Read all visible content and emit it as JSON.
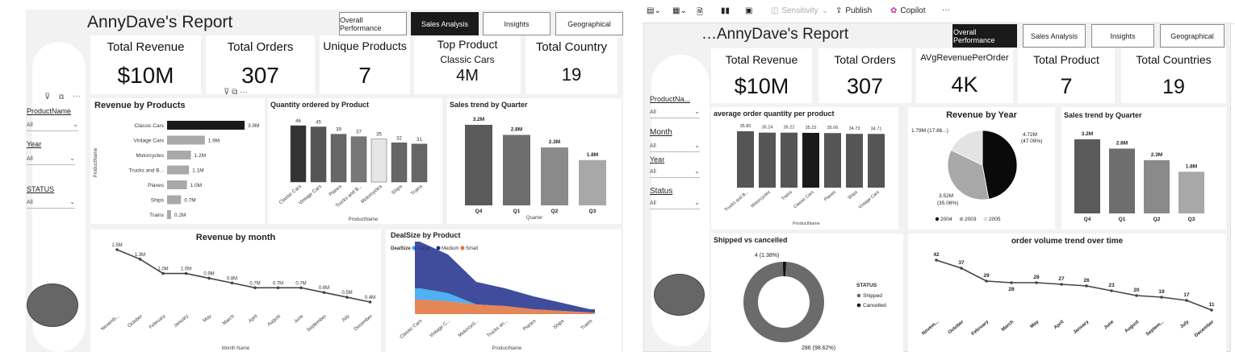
{
  "left": {
    "title": "AnnyDave's Report",
    "nav": [
      "Overall Performance",
      "Sales Analysis",
      "Insights",
      "Geographical"
    ],
    "nav_active": 1,
    "kpis": [
      {
        "title": "Total Revenue",
        "value": "$10M"
      },
      {
        "title": "Total Orders",
        "value": "307"
      },
      {
        "title": "Unique Products",
        "value": "7"
      },
      {
        "title": "Top Product",
        "subtitle": "Classic Cars",
        "value": "4M"
      },
      {
        "title": "Total Country",
        "value": "19"
      }
    ],
    "slicers": [
      {
        "label": "ProductName",
        "value": "All"
      },
      {
        "label": "Year",
        "value": "All"
      },
      {
        "label": "STATUS",
        "value": "All"
      }
    ],
    "revenue_by_products": {
      "title": "Revenue by Products",
      "ylabel": "ProductName",
      "categories": [
        "Classic Cars",
        "Vintage Cars",
        "Motorcycles",
        "Trucks and B...",
        "Planes",
        "Ships",
        "Trains"
      ],
      "values": [
        3.9,
        1.9,
        1.2,
        1.1,
        1.0,
        0.7,
        0.2
      ],
      "labels": [
        "3.9M",
        "1.9M",
        "1.2M",
        "1.1M",
        "1.0M",
        "0.7M",
        "0.2M"
      ]
    },
    "quantity_by_product": {
      "title": "Quantity ordered by Product",
      "xlabel": "ProductName",
      "categories": [
        "Classic Cars",
        "Vintage Cars",
        "Planes",
        "Trucks and B...",
        "Motorcycles",
        "Ships",
        "Trains"
      ],
      "values": [
        46,
        45,
        39,
        37,
        35,
        32,
        31
      ]
    },
    "sales_trend_quarter": {
      "title": "Sales trend by Quarter",
      "xlabel": "Quarter",
      "categories": [
        "Q4",
        "Q1",
        "Q2",
        "Q3"
      ],
      "values": [
        3.2,
        2.8,
        2.3,
        1.8
      ],
      "labels": [
        "3.2M",
        "2.8M",
        "2.3M",
        "1.8M"
      ]
    },
    "revenue_by_month": {
      "title": "Revenue by month",
      "xlabel": "Month Name",
      "categories": [
        "Novemb...",
        "October",
        "February",
        "January",
        "May",
        "March",
        "April",
        "August",
        "June",
        "September",
        "July",
        "December"
      ],
      "values": [
        1.5,
        1.3,
        1.0,
        1.0,
        0.9,
        0.8,
        0.7,
        0.7,
        0.7,
        0.6,
        0.5,
        0.4
      ],
      "labels": [
        "1.5M",
        "1.3M",
        "1.0M",
        "1.0M",
        "0.9M",
        "0.8M",
        "0.7M",
        "0.7M",
        "0.7M",
        "0.6M",
        "0.5M",
        "0.4M"
      ]
    },
    "dealsize_by_product": {
      "title": "DealSize by Product",
      "legend_title": "DealSize",
      "legend": [
        {
          "name": "Large",
          "color": "#2ea3f2"
        },
        {
          "name": "Medium",
          "color": "#1f2e8c"
        },
        {
          "name": "Small",
          "color": "#e0713a"
        }
      ],
      "xlabel": "ProductName",
      "categories": [
        "Classic Cars",
        "Vintage C...",
        "Motorcycl...",
        "Trucks an...",
        "Planes",
        "Ships",
        "Trains"
      ]
    }
  },
  "right": {
    "toolbar": {
      "sensitivity": "Sensitivity",
      "publish": "Publish",
      "copilot": "Copilot",
      "more": "···"
    },
    "title": "AnnyDave's Report",
    "nav": [
      "Overall Performance",
      "Sales Analysis",
      "Insights",
      "Geographical"
    ],
    "nav_active": 0,
    "kpis": [
      {
        "title": "Total Revenue",
        "value": "$10M"
      },
      {
        "title": "Total Orders",
        "value": "307"
      },
      {
        "title": "AVgRevenuePerOrder",
        "value": "4K"
      },
      {
        "title": "Total Product",
        "value": "7"
      },
      {
        "title": "Total Countries",
        "value": "19"
      }
    ],
    "slicers": [
      {
        "label": "ProductNa...",
        "value": "All"
      },
      {
        "label": "Month",
        "value": "All"
      },
      {
        "label": "Year",
        "value": "All"
      },
      {
        "label": "Status",
        "value": "All"
      }
    ],
    "avg_order_qty": {
      "title": "average order quantity per product",
      "xlabel": "ProductName",
      "categories": [
        "Trucks and B...",
        "Motorcycles",
        "Trains",
        "Classic Cars",
        "Planes",
        "Ships",
        "Vintage Cars"
      ],
      "values": [
        35.8,
        35.24,
        35.22,
        35.15,
        35.06,
        34.73,
        34.71
      ],
      "labels": [
        "35.80",
        "35.24",
        "35.22",
        "35.15",
        "35.06",
        "34.73",
        "34.71"
      ]
    },
    "revenue_by_year": {
      "title": "Revenue by Year",
      "slices": [
        {
          "year": "2004",
          "value": 4.72,
          "label": "4.72M\n(47.09%)",
          "color": "#0a0a0a"
        },
        {
          "year": "2003",
          "value": 3.52,
          "label": "3.52M\n(35.06%)",
          "color": "#a8a8a8"
        },
        {
          "year": "2005",
          "value": 1.79,
          "label": "1.79M (17.86...)",
          "color": "#e3e3e3"
        }
      ],
      "label_2004": [
        "4.72M",
        "(47.09%)"
      ],
      "label_2003": [
        "3.52M",
        "(35.06%)"
      ],
      "label_2005": "1.79M (17.86...)"
    },
    "sales_trend_quarter": {
      "title": "Sales trend by Quarter",
      "categories": [
        "Q4",
        "Q1",
        "Q2",
        "Q3"
      ],
      "values": [
        3.2,
        2.8,
        2.3,
        1.8
      ],
      "labels": [
        "3.2M",
        "2.8M",
        "2.3M",
        "1.8M"
      ]
    },
    "shipped_vs_cancelled": {
      "title": "Shipped vs cancelled",
      "legend_title": "STATUS",
      "slices": [
        {
          "name": "Shipped",
          "value": 286,
          "label": "286 (98.62%)",
          "color": "#6b6b6b"
        },
        {
          "name": "Cancelled",
          "value": 4,
          "label": "4 (1.38%)",
          "color": "#111111"
        }
      ]
    },
    "order_volume_trend": {
      "title": "order volume trend over time",
      "categories": [
        "Novem...",
        "October",
        "February",
        "March",
        "May",
        "April",
        "January",
        "June",
        "August",
        "Septem...",
        "July",
        "December"
      ],
      "values": [
        42,
        37,
        29,
        28,
        28,
        27,
        26,
        23,
        20,
        19,
        17,
        11
      ]
    }
  },
  "chart_data": [
    {
      "type": "bar",
      "title": "Revenue by Products",
      "categories": [
        "Classic Cars",
        "Vintage Cars",
        "Motorcycles",
        "Trucks and B...",
        "Planes",
        "Ships",
        "Trains"
      ],
      "values": [
        3.9,
        1.9,
        1.2,
        1.1,
        1.0,
        0.7,
        0.2
      ],
      "ylabel": "ProductName"
    },
    {
      "type": "bar",
      "title": "Quantity ordered by Product",
      "categories": [
        "Classic Cars",
        "Vintage Cars",
        "Planes",
        "Trucks and B...",
        "Motorcycles",
        "Ships",
        "Trains"
      ],
      "values": [
        46,
        45,
        39,
        37,
        35,
        32,
        31
      ],
      "xlabel": "ProductName"
    },
    {
      "type": "bar",
      "title": "Sales trend by Quarter",
      "categories": [
        "Q4",
        "Q1",
        "Q2",
        "Q3"
      ],
      "values": [
        3.2,
        2.8,
        2.3,
        1.8
      ],
      "xlabel": "Quarter"
    },
    {
      "type": "line",
      "title": "Revenue by month",
      "categories": [
        "Novemb...",
        "October",
        "February",
        "January",
        "May",
        "March",
        "April",
        "August",
        "June",
        "September",
        "July",
        "December"
      ],
      "values": [
        1.5,
        1.3,
        1.0,
        1.0,
        0.9,
        0.8,
        0.7,
        0.7,
        0.7,
        0.6,
        0.5,
        0.4
      ],
      "xlabel": "Month Name"
    },
    {
      "type": "area",
      "title": "DealSize by Product",
      "categories": [
        "Classic Cars",
        "Vintage C...",
        "Motorcycl...",
        "Trucks an...",
        "Planes",
        "Ships",
        "Trains"
      ],
      "series": [
        {
          "name": "Large"
        },
        {
          "name": "Medium"
        },
        {
          "name": "Small"
        }
      ],
      "xlabel": "ProductName"
    },
    {
      "type": "bar",
      "title": "average order quantity per product",
      "categories": [
        "Trucks and B...",
        "Motorcycles",
        "Trains",
        "Classic Cars",
        "Planes",
        "Ships",
        "Vintage Cars"
      ],
      "values": [
        35.8,
        35.24,
        35.22,
        35.15,
        35.06,
        34.73,
        34.71
      ],
      "xlabel": "ProductName"
    },
    {
      "type": "pie",
      "title": "Revenue by Year",
      "categories": [
        "2004",
        "2003",
        "2005"
      ],
      "values": [
        4.72,
        3.52,
        1.79
      ]
    },
    {
      "type": "bar",
      "title": "Sales trend by Quarter",
      "categories": [
        "Q4",
        "Q1",
        "Q2",
        "Q3"
      ],
      "values": [
        3.2,
        2.8,
        2.3,
        1.8
      ]
    },
    {
      "type": "pie",
      "title": "Shipped vs cancelled",
      "categories": [
        "Shipped",
        "Cancelled"
      ],
      "values": [
        286,
        4
      ]
    },
    {
      "type": "line",
      "title": "order volume trend over time",
      "categories": [
        "Novem...",
        "October",
        "February",
        "March",
        "May",
        "April",
        "January",
        "June",
        "August",
        "Septem...",
        "July",
        "December"
      ],
      "values": [
        42,
        37,
        29,
        28,
        28,
        27,
        26,
        23,
        20,
        19,
        17,
        11
      ]
    }
  ]
}
